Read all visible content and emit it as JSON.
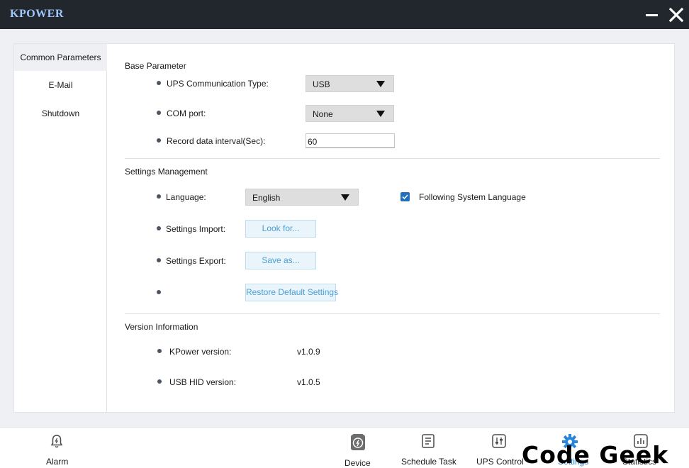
{
  "app": {
    "title": "KPOWER"
  },
  "window": {
    "minimize_icon": "minimize-icon",
    "close_icon": "close-icon"
  },
  "sidebar": {
    "items": [
      {
        "label": "Common Parameters",
        "active": true
      },
      {
        "label": "E-Mail",
        "active": false
      },
      {
        "label": "Shutdown",
        "active": false
      }
    ]
  },
  "base_parameter": {
    "title": "Base Parameter",
    "comm_type_label": "UPS Communication Type:",
    "comm_type_value": "USB",
    "com_port_label": "COM port:",
    "com_port_value": "None",
    "record_interval_label": "Record data interval(Sec):",
    "record_interval_value": "60"
  },
  "settings_management": {
    "title": "Settings Management",
    "language_label": "Language:",
    "language_value": "English",
    "follow_system_label": "Following System Language",
    "follow_system_checked": true,
    "import_label": "Settings Import:",
    "import_button": "Look for...",
    "export_label": "Settings Export:",
    "export_button": "Save as...",
    "restore_button": "Restore Default Settings"
  },
  "version_information": {
    "title": "Version Information",
    "kpower_label": "KPower version:",
    "kpower_value": "v1.0.9",
    "usbhid_label": "USB HID version:",
    "usbhid_value": "v1.0.5"
  },
  "bottom_nav": {
    "alarm": {
      "label": "Alarm",
      "icon": "alarm-bell-icon"
    },
    "device": {
      "label": "Device",
      "icon": "device-icon"
    },
    "schedule": {
      "label": "Schedule Task",
      "icon": "schedule-icon"
    },
    "ups_control": {
      "label": "UPS Control",
      "icon": "ups-control-icon"
    },
    "settings": {
      "label": "Settings",
      "icon": "gear-icon"
    },
    "statistics": {
      "label": "Statistics",
      "icon": "chart-icon"
    }
  },
  "watermark": {
    "text": "Code Geek"
  },
  "colors": {
    "titlebar": "#22272d",
    "accent": "#1f6fbf",
    "button_text": "#4a9ed4"
  }
}
